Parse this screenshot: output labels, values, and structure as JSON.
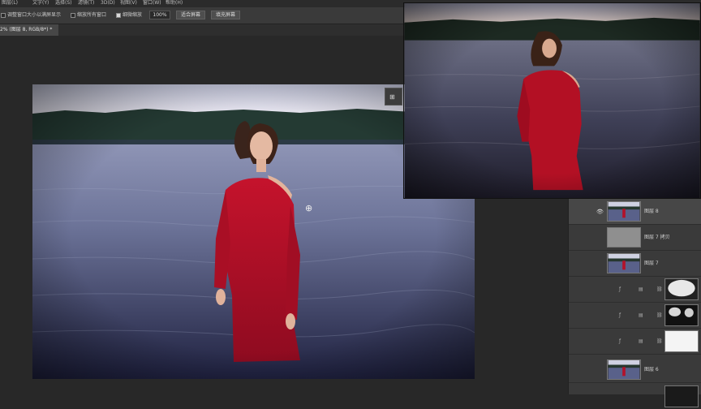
{
  "menubar": {
    "items": [
      "图层(L)",
      "文字(Y)",
      "选择(S)",
      "滤镜(T)",
      "3D(D)",
      "视图(V)",
      "窗口(W)",
      "帮助(H)"
    ]
  },
  "options_bar": {
    "resize_label": "调整窗口大小以满屏显示",
    "zoom_all_label": "缩放所有窗口",
    "scrubby_zoom_label": "细微缩放",
    "zoom_value": "100%",
    "fit_screen_button": "适合屏幕",
    "fill_screen_button": "填充屏幕"
  },
  "document_tab": {
    "label": "2% (图层 8, RGB/8*) *"
  },
  "layers": [
    {
      "name": "图层 8",
      "thumb": "photo",
      "visible": true,
      "selected": true
    },
    {
      "name": "图层 7 拷贝",
      "thumb": "gray",
      "visible": false,
      "selected": false
    },
    {
      "name": "图层 7",
      "thumb": "photo",
      "visible": false,
      "selected": false
    },
    {
      "name": "",
      "thumb": "mask-blur",
      "visible": false,
      "selected": false
    },
    {
      "name": "",
      "thumb": "mask-dark",
      "visible": false,
      "selected": false
    },
    {
      "name": "",
      "thumb": "mask-white",
      "visible": false,
      "selected": false
    },
    {
      "name": "图层 6",
      "thumb": "photo",
      "visible": false,
      "selected": false
    }
  ],
  "colors": {
    "dress_red": "#b3122a",
    "water": "#5d6688",
    "sky": "#dfe1ee"
  }
}
